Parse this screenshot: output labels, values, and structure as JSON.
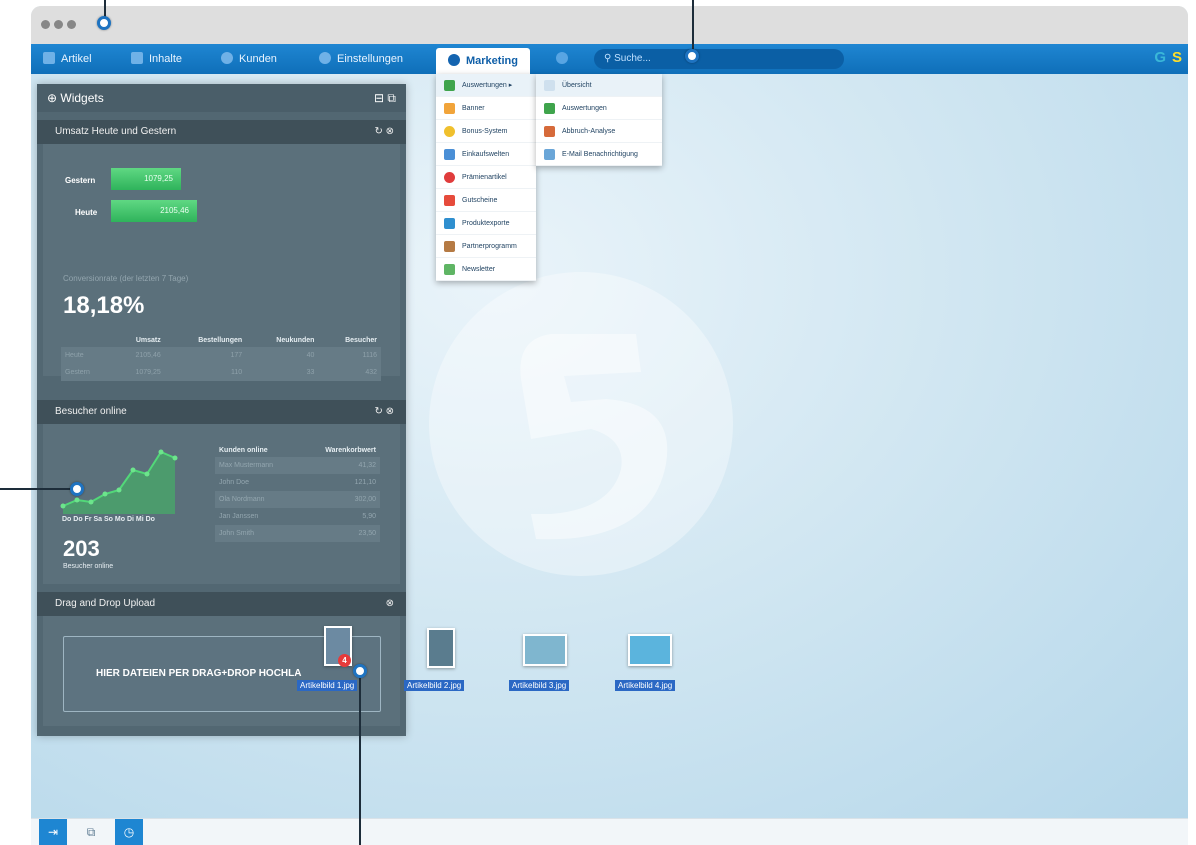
{
  "menubar": {
    "items": [
      "Artikel",
      "Inhalte",
      "Kunden",
      "Einstellungen",
      "Marketing"
    ],
    "search_placeholder": "Suche..."
  },
  "panel": {
    "title": "Widgets",
    "revenue": {
      "title": "Umsatz Heute und Gestern",
      "yesterday_label": "Gestern",
      "yesterday_value": "1079,25",
      "today_label": "Heute",
      "today_value": "2105,46",
      "conversion_label": "Conversionrate (der letzten 7 Tage)",
      "conversion_value": "18,18%",
      "columns": [
        "Umsatz",
        "Bestellungen",
        "Neukunden",
        "Besucher"
      ],
      "rows": [
        {
          "label": "Heute",
          "values": [
            "2105,46",
            "177",
            "40",
            "1116"
          ]
        },
        {
          "label": "Gestern",
          "values": [
            "1079,25",
            "110",
            "33",
            "432"
          ]
        }
      ]
    },
    "visitors": {
      "title": "Besucher online",
      "days": "Do Do Fr Sa So Mo Di Mi Do",
      "count": "203",
      "count_label": "Besucher online",
      "columns": [
        "Kunden online",
        "Warenkorbwert"
      ],
      "rows": [
        {
          "name": "Max Mustermann",
          "value": "41,32"
        },
        {
          "name": "John Doe",
          "value": "121,10"
        },
        {
          "name": "Ola Nordmann",
          "value": "302,00"
        },
        {
          "name": "Jan Janssen",
          "value": "5,90"
        },
        {
          "name": "John Smith",
          "value": "23,50"
        }
      ]
    },
    "upload": {
      "title": "Drag and Drop Upload",
      "hint": "HIER DATEIEN PER DRAG+DROP HOCHLA",
      "badge": "4",
      "files": [
        "Artikelbild 1.jpg",
        "Artikelbild 2.jpg",
        "Artikelbild 3.jpg",
        "Artikelbild 4.jpg"
      ]
    }
  },
  "marketing_menu": [
    "Auswertungen",
    "Banner",
    "Bonus-System",
    "Einkaufswelten",
    "Prämienartikel",
    "Gutscheine",
    "Produktexporte",
    "Partnerprogramm",
    "Newsletter"
  ],
  "submenu": [
    "Übersicht",
    "Auswertungen",
    "Abbruch-Analyse",
    "E-Mail Benachrichtigung"
  ],
  "colors": {
    "accent": "#1e86d2",
    "green": "#3fc26a"
  }
}
